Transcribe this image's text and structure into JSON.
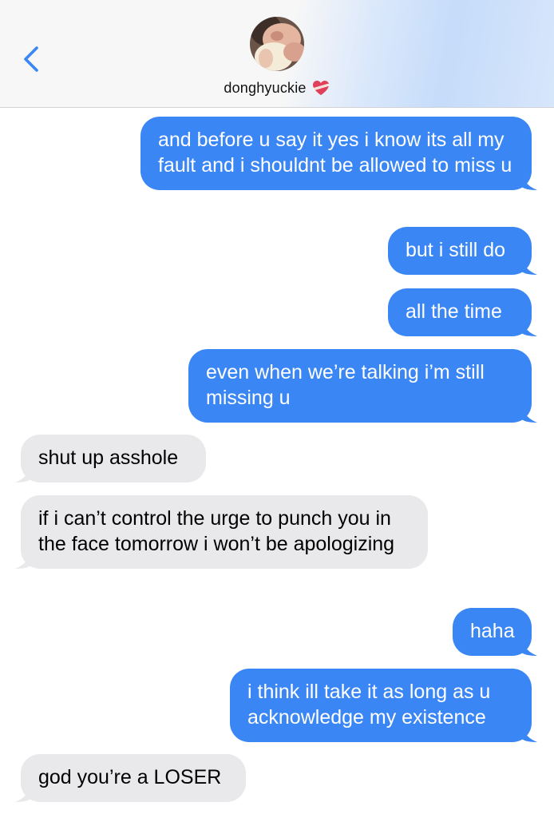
{
  "header": {
    "contact_name": "donghyuckie",
    "back_icon": "chevron-left-icon",
    "avatar_icon": "contact-avatar",
    "heart_icon": "mending-heart-icon"
  },
  "colors": {
    "sent_bubble": "#3a86f5",
    "received_bubble": "#e9e9eb",
    "accent": "#3a86f5"
  },
  "messages": [
    {
      "direction": "sent",
      "text": "and before u say it yes i know its all my fault and i shouldnt be allowed to miss u"
    },
    {
      "direction": "sent",
      "text": "but i still do"
    },
    {
      "direction": "sent",
      "text": "all the time"
    },
    {
      "direction": "sent",
      "text": "even when we’re talking i’m still missing u"
    },
    {
      "direction": "received",
      "text": "shut up asshole"
    },
    {
      "direction": "received",
      "text": "if i can’t control the urge to punch you in the face tomorrow i won’t be apologizing"
    },
    {
      "direction": "sent",
      "text": "haha"
    },
    {
      "direction": "sent",
      "text": "i think ill take it as long as u acknowledge my existence"
    },
    {
      "direction": "received",
      "text": "god you’re a LOSER"
    }
  ]
}
